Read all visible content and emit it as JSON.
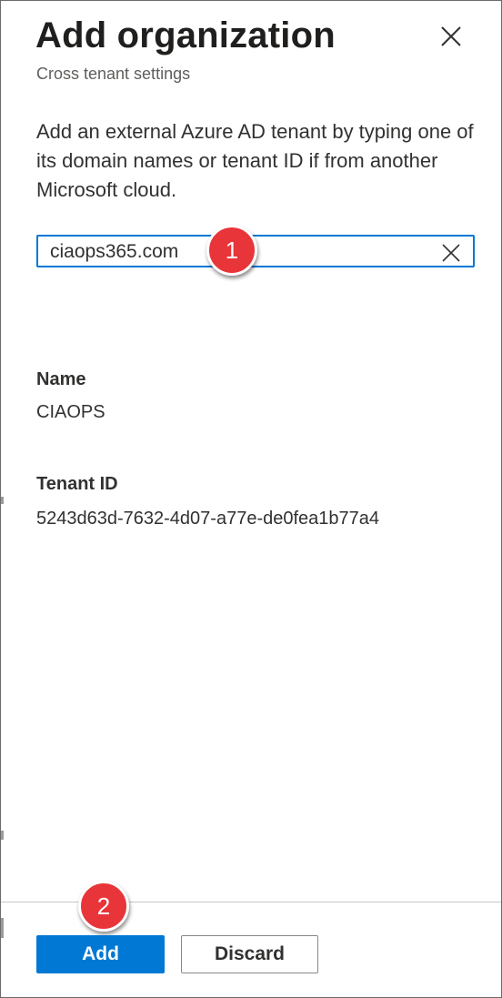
{
  "panel": {
    "title": "Add organization",
    "subtitle": "Cross tenant settings",
    "close_icon": "close-icon"
  },
  "description": "Add an external Azure AD tenant by typing one of its domain names or tenant ID if from another Microsoft cloud.",
  "search": {
    "value": "ciaops365.com",
    "clear_icon": "clear-icon"
  },
  "details": {
    "name_label": "Name",
    "name_value": "CIAOPS",
    "tenant_label": "Tenant ID",
    "tenant_value": "5243d63d-7632-4d07-a77e-de0fea1b77a4"
  },
  "annotations": {
    "step1": "1",
    "step2": "2",
    "color": "#e8353a"
  },
  "footer": {
    "add_label": "Add",
    "discard_label": "Discard"
  },
  "colors": {
    "accent": "#0078d4",
    "text": "#323130",
    "subtle": "#605e5c"
  }
}
